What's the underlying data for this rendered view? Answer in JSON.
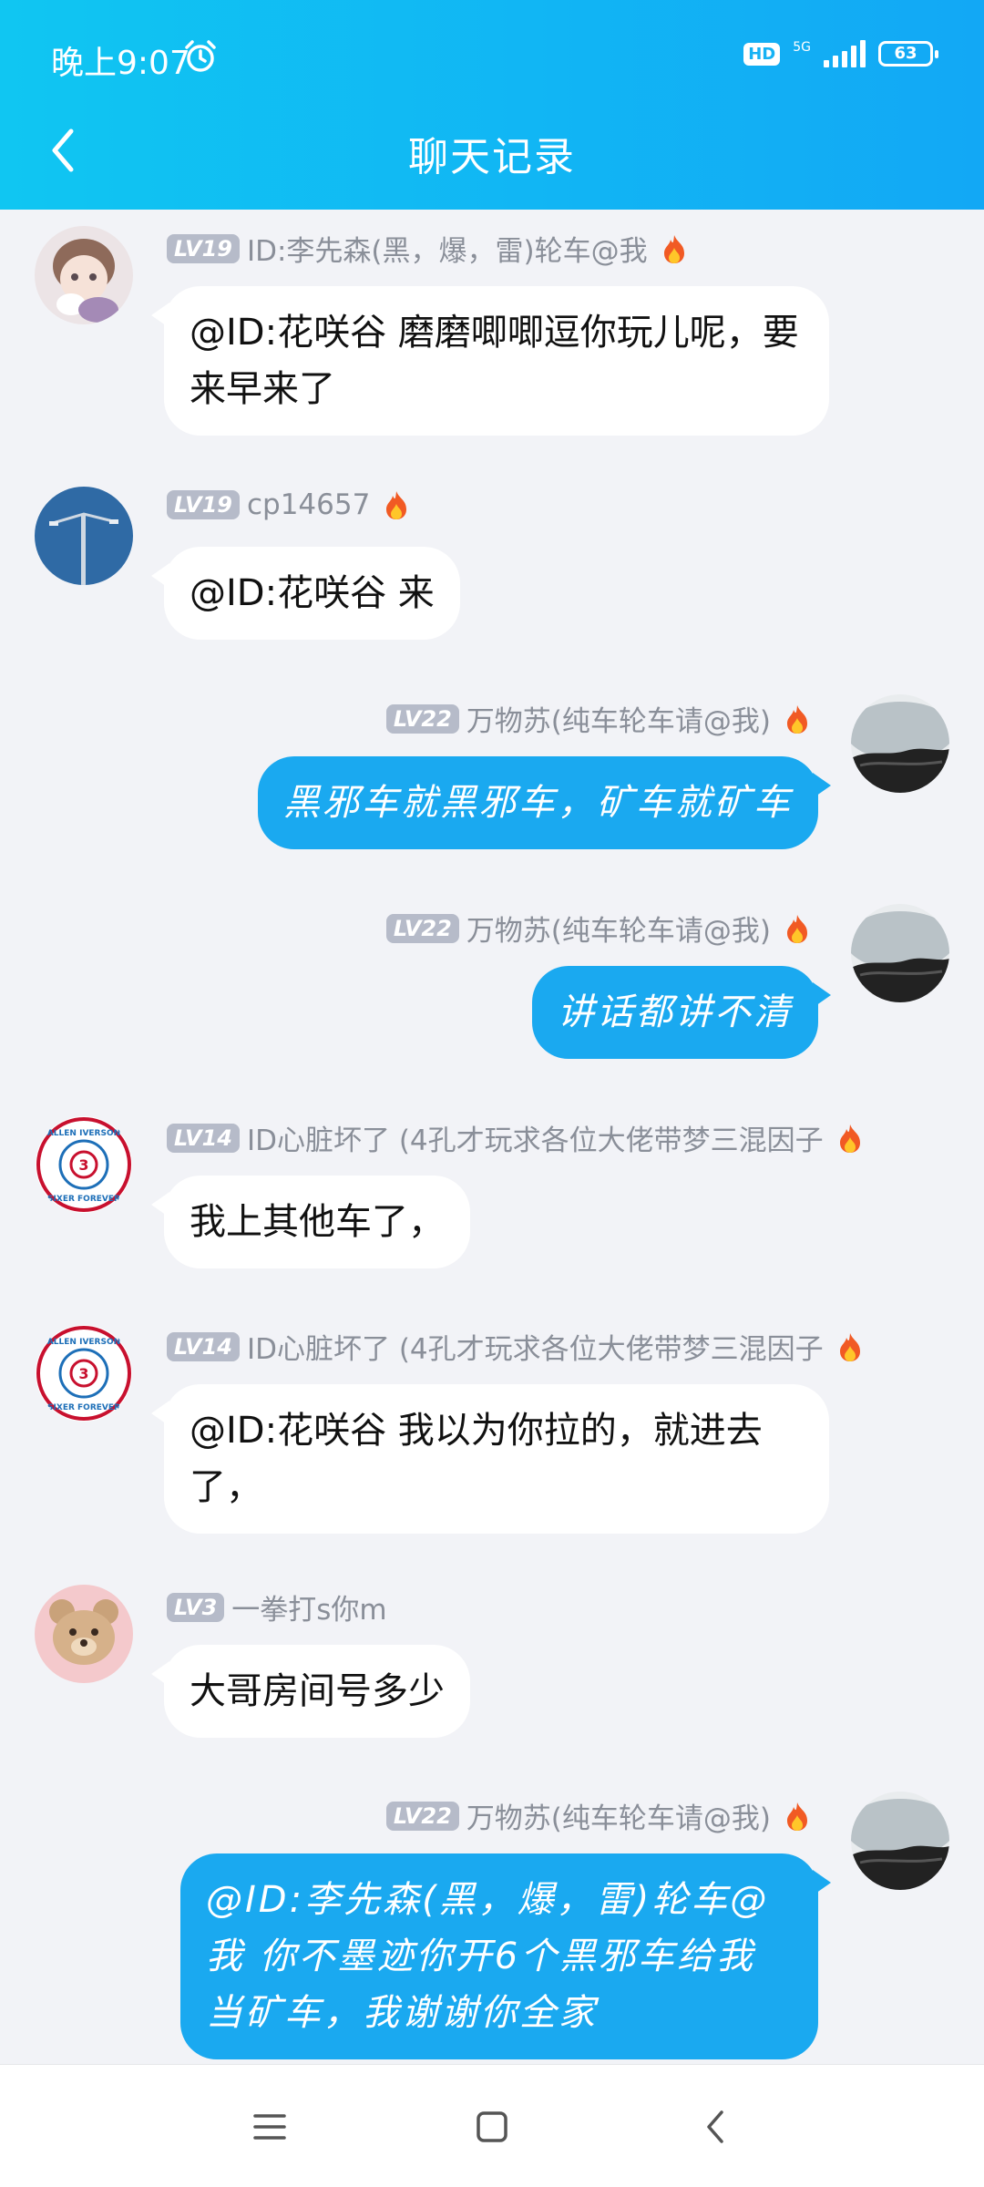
{
  "status": {
    "time": "晚上9:07",
    "hd": "HD",
    "network": "5G",
    "battery": "63"
  },
  "header": {
    "title": "聊天记录"
  },
  "messages": [
    {
      "side": "left",
      "level": "LV19",
      "name": "ID:李先森(黑，爆，雷)轮车@我",
      "text": "@ID:花咲谷 磨磨唧唧逗你玩儿呢，要来早来了",
      "avatar": "anime-avatar-icon"
    },
    {
      "side": "left",
      "level": "LV19",
      "name": "cp14657",
      "text": "@ID:花咲谷 来",
      "avatar": "lamp-avatar-icon"
    },
    {
      "side": "right",
      "level": "LV22",
      "name": "万物苏(纯车轮车请@我)",
      "text": "黑邪车就黑邪车，矿车就矿车",
      "avatar": "landscape-avatar-icon"
    },
    {
      "side": "right",
      "level": "LV22",
      "name": "万物苏(纯车轮车请@我)",
      "text": "讲话都讲不清",
      "avatar": "landscape-avatar-icon"
    },
    {
      "side": "left",
      "level": "LV14",
      "name": "ID心脏坏了 (4孔才玩求各位大佬带梦三混因子",
      "text": "我上其他车了，",
      "avatar": "iverson-badge-avatar-icon"
    },
    {
      "side": "left",
      "level": "LV14",
      "name": "ID心脏坏了 (4孔才玩求各位大佬带梦三混因子",
      "text": "@ID:花咲谷 我以为你拉的，就进去了，",
      "avatar": "iverson-badge-avatar-icon"
    },
    {
      "side": "left",
      "level": "LV3",
      "name": "一拳打s你m",
      "text": "大哥房间号多少",
      "avatar": "teddy-bear-avatar-icon"
    },
    {
      "side": "right",
      "level": "LV22",
      "name": "万物苏(纯车轮车请@我)",
      "text": "@ID:李先森(黑，爆，雷)轮车@我 你不墨迹你开6个黑邪车给我当矿车，我谢谢你全家",
      "avatar": "landscape-avatar-icon"
    }
  ],
  "badge_text": {
    "iverson_top": "ALLEN IVERSON",
    "iverson_bottom": "SIXER FOREVER",
    "iverson_number": "3"
  },
  "colors": {
    "header_start": "#10c6f2",
    "header_end": "#12a8f5",
    "self_bubble": "#1aa9f0",
    "other_bubble": "#ffffff",
    "background": "#f2f3f7"
  }
}
